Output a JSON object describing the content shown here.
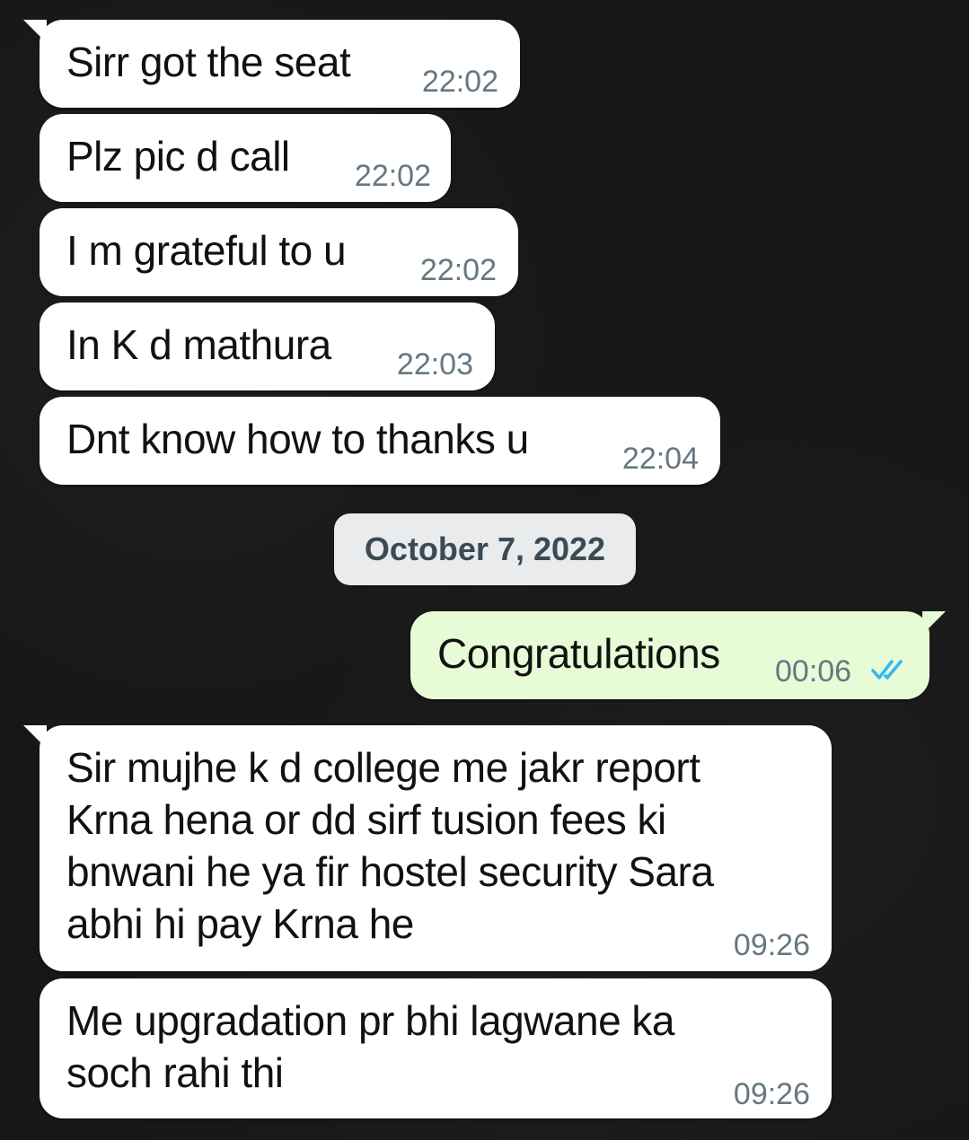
{
  "messages": [
    {
      "text": "Sirr got the seat",
      "time": "22:02"
    },
    {
      "text": "Plz pic d call",
      "time": "22:02"
    },
    {
      "text": "I m grateful to u",
      "time": "22:02"
    },
    {
      "text": "In K d mathura",
      "time": "22:03"
    },
    {
      "text": "Dnt know how to thanks u",
      "time": "22:04"
    },
    {
      "text": "Congratulations",
      "time": "00:06"
    },
    {
      "text": "Sir mujhe k d college me jakr report\nKrna hena or dd sirf tusion fees ki\nbnwani he ya fir hostel security Sara\nabhi hi pay Krna he",
      "time": "09:26"
    },
    {
      "text": "Me upgradation pr bhi lagwane ka\nsoch rahi thi",
      "time": "09:26"
    }
  ],
  "date_divider": "October 7, 2022",
  "read_receipt_icon": "double-check-icon",
  "colors": {
    "background": "#171717",
    "incoming_bubble": "#ffffff",
    "outgoing_bubble": "#e7fbd6",
    "timestamp": "#667781",
    "read_ticks": "#34b7f1",
    "date_chip": "#e9ebec"
  }
}
